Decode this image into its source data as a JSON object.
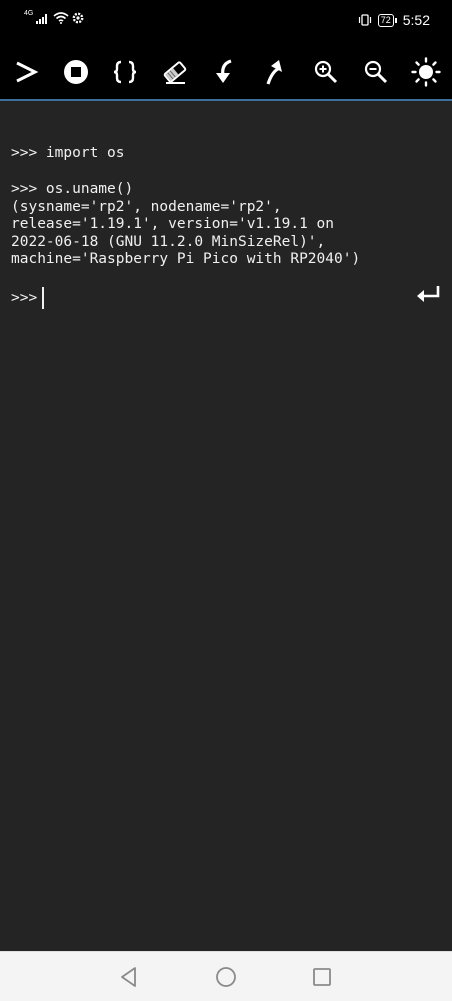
{
  "status_bar": {
    "network": "4G",
    "battery": "72",
    "time": "5:52"
  },
  "toolbar": {
    "icons": [
      "run-icon",
      "stop-icon",
      "braces-icon",
      "eraser-icon",
      "download-icon",
      "upload-icon",
      "zoom-in-icon",
      "zoom-out-icon",
      "brightness-icon"
    ]
  },
  "console": {
    "lines": [
      ">>> import os",
      ">>> os.uname()\n(sysname='rp2', nodename='rp2',\nrelease='1.19.1', version='v1.19.1 on\n2022-06-18 (GNU 11.2.0 MinSizeRel)',\nmachine='Raspberry Pi Pico with RP2040')"
    ],
    "prompt": ">>>"
  },
  "colors": {
    "background": "#242424",
    "toolbar": "#000000",
    "accent": "#3d6f9d",
    "navbar": "#f4f4f4"
  }
}
